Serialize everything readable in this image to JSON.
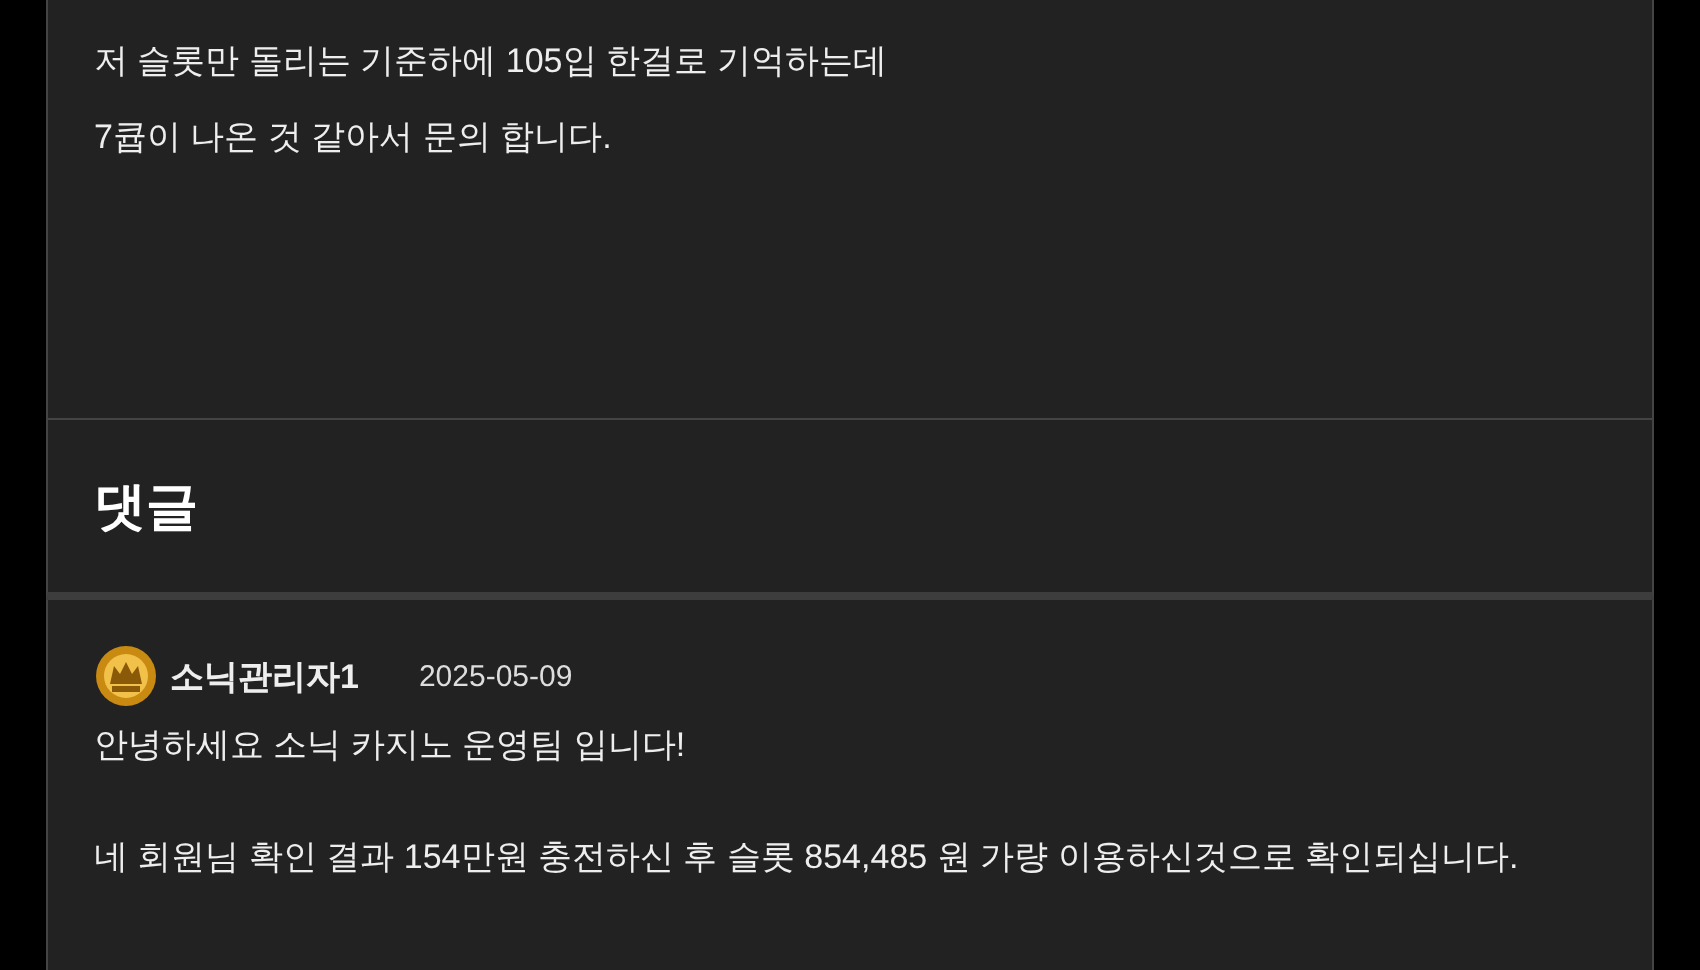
{
  "post": {
    "body_lines": [
      "저 슬롯만 돌리는 기준하에 105입 한걸로 기억하는데",
      "7큡이 나온 것 같아서 문의 합니다."
    ]
  },
  "comments_section": {
    "title": "댓글"
  },
  "comments": [
    {
      "author": "소닉관리자1",
      "date": "2025-05-09",
      "paragraphs": [
        "안녕하세요 소닉 카지노 운영팀 입니다!",
        "네 회원님 확인 결과 154만원 충전하신 후 슬롯 854,485 원 가량 이용하신것으로 확인되십니다."
      ]
    }
  ]
}
